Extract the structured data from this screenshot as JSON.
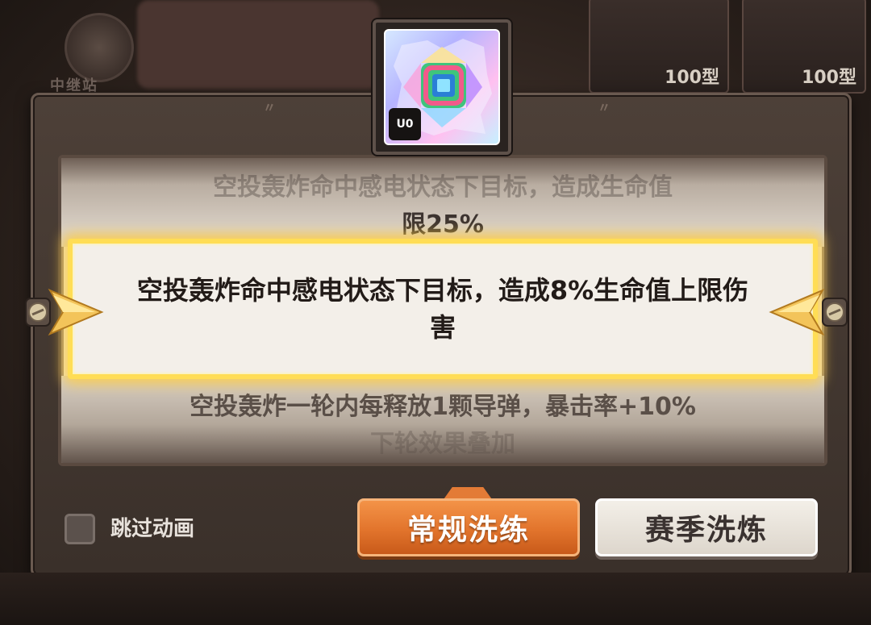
{
  "background": {
    "card_quantities": [
      "100型",
      "100型"
    ],
    "emblem_label": "中继站"
  },
  "item_icon": {
    "name": "rainbow-gem-icon",
    "badge": "U0"
  },
  "options": {
    "previous": {
      "line1": "空投轰炸命中感电状态下目标，造成生命值",
      "line2": "限25%"
    },
    "selected": {
      "text": "空投轰炸命中感电状态下目标，造成8%生命值上限伤害"
    },
    "next": {
      "line1": "空投轰炸一轮内每释放1颗导弹，暴击率+10%",
      "line2": "下轮效果叠加"
    }
  },
  "controls": {
    "skip_animation_label": "跳过动画",
    "skip_animation_checked": false,
    "primary_button": "常规洗练",
    "secondary_button": "赛季洗炼"
  },
  "colors": {
    "primary_button": "#e2742c",
    "selected_glow": "#ffdd55",
    "panel": "#4d4038"
  }
}
